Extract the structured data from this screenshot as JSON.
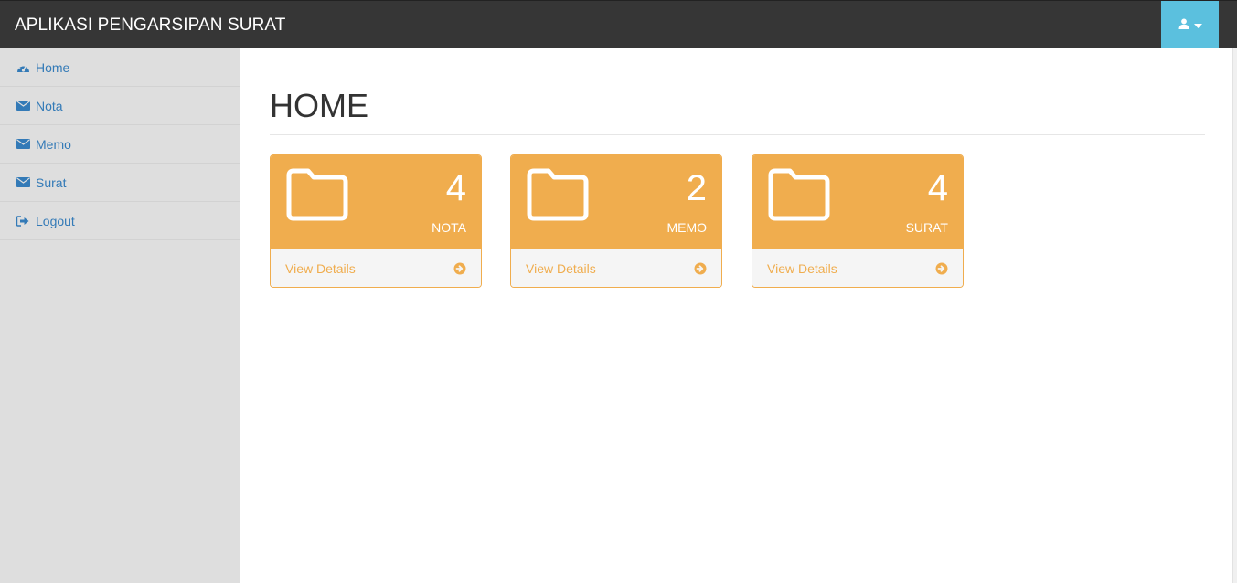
{
  "header": {
    "title": "APLIKASI PENGARSIPAN SURAT",
    "user_icon": "user-icon",
    "caret_icon": "caret-down-icon",
    "accent_color": "#5bc0de",
    "bar_color": "#363636"
  },
  "sidebar": {
    "items": [
      {
        "label": "Home",
        "icon": "dashboard-icon"
      },
      {
        "label": "Nota",
        "icon": "envelope-icon"
      },
      {
        "label": "Memo",
        "icon": "envelope-icon"
      },
      {
        "label": "Surat",
        "icon": "envelope-icon"
      },
      {
        "label": "Logout",
        "icon": "sign-out-icon"
      }
    ]
  },
  "main": {
    "title": "HOME",
    "cards": [
      {
        "count": "4",
        "label": "NOTA",
        "link": "View Details",
        "icon": "folder-icon"
      },
      {
        "count": "2",
        "label": "MEMO",
        "link": "View Details",
        "icon": "folder-icon"
      },
      {
        "count": "4",
        "label": "SURAT",
        "link": "View Details",
        "icon": "folder-icon"
      }
    ],
    "card_color": "#f0ad4e"
  }
}
